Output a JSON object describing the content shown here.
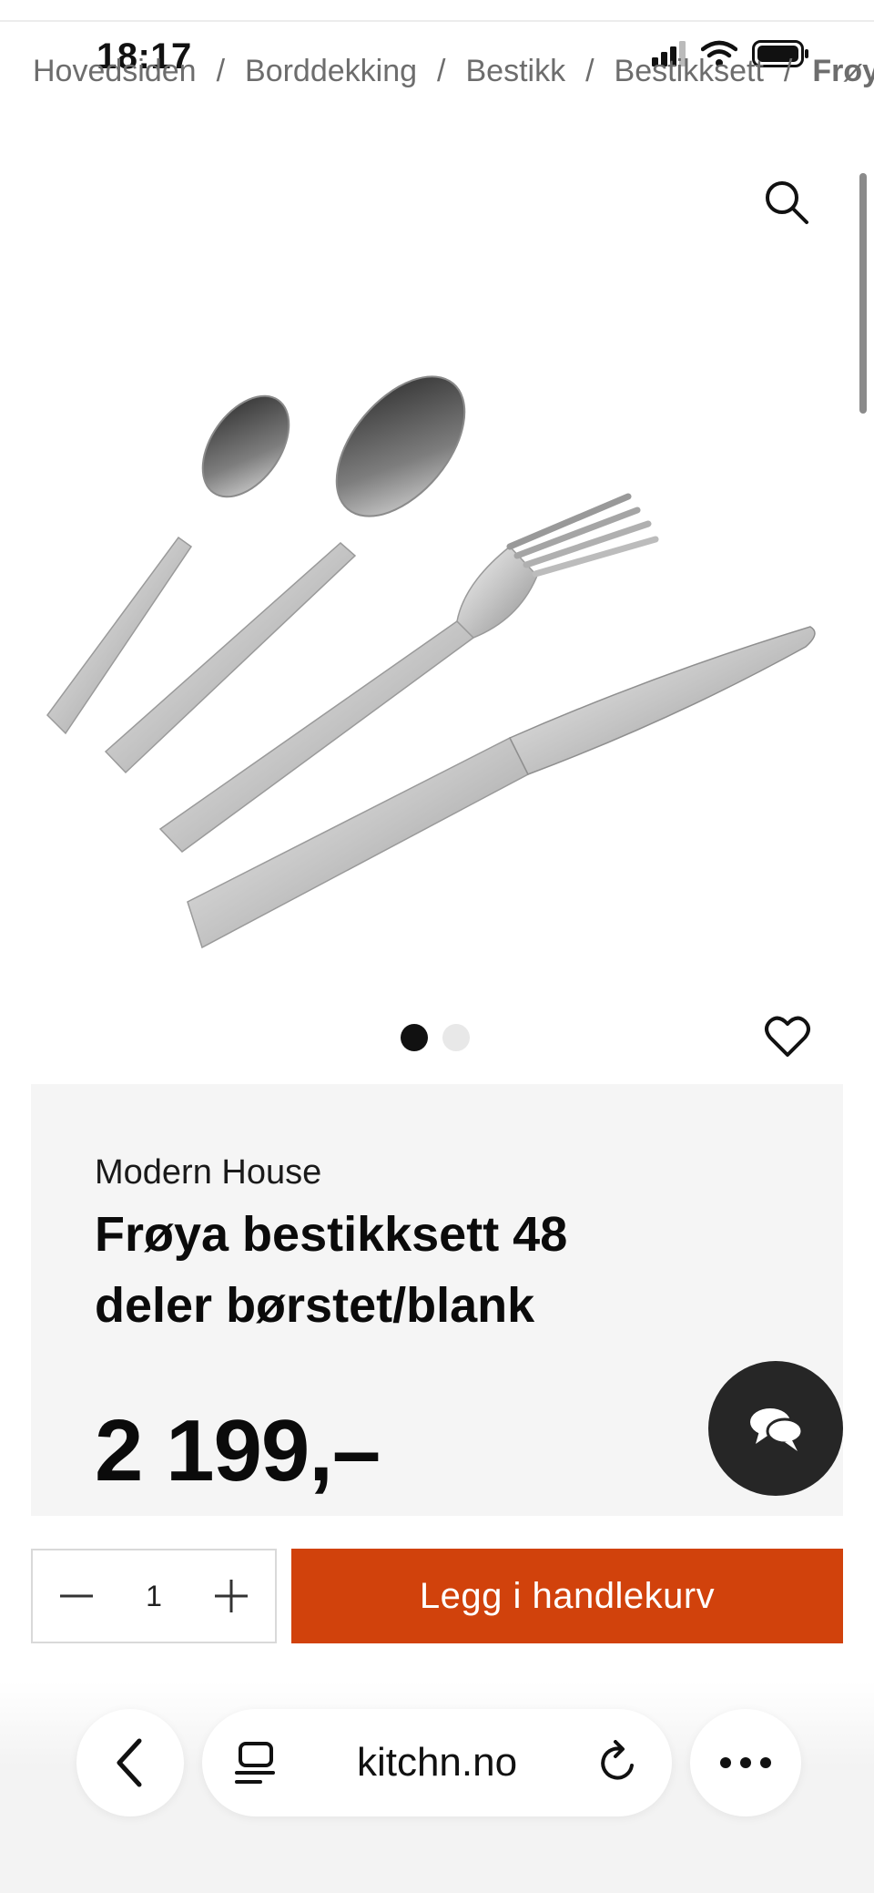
{
  "status_bar": {
    "time": "18:17"
  },
  "breadcrumb": {
    "items": [
      "Hovedsiden",
      "Borddekking",
      "Bestikk",
      "Bestikksett"
    ],
    "current": "Frøya",
    "separator": "/"
  },
  "product": {
    "brand": "Modern House",
    "title": "Frøya bestikksett 48 deler børstet/blank",
    "price": "2 199,–",
    "gallery": {
      "images_total": 2,
      "active_index": 1
    }
  },
  "purchase": {
    "quantity": "1",
    "add_to_cart_label": "Legg i handlekurv"
  },
  "browser": {
    "url": "kitchn.no"
  },
  "colors": {
    "accent": "#d1420c",
    "chat_button": "#262626",
    "card_bg": "#f5f5f5"
  },
  "icons": {
    "search": "search-icon",
    "wishlist": "heart-icon",
    "chat": "chat-icon",
    "minus": "minus-icon",
    "plus": "plus-icon",
    "back": "chevron-left-icon",
    "tabs": "tabs-icon",
    "reload": "reload-icon",
    "more": "more-icon"
  }
}
